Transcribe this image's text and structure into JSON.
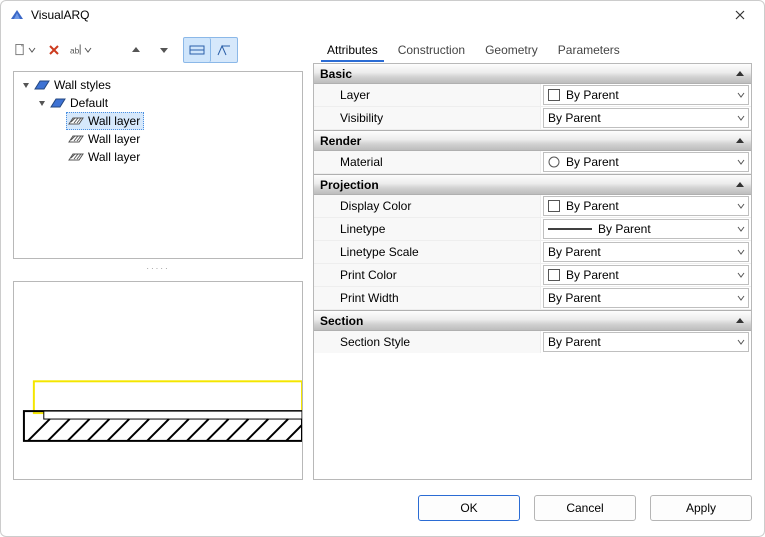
{
  "window": {
    "title": "VisualARQ"
  },
  "toolbar": {
    "icons": {
      "new": "new-icon",
      "delete": "delete-icon",
      "rename": "rename-icon",
      "up": "up-icon",
      "down": "down-icon",
      "wall_view": "wall-view-icon",
      "section_view": "section-view-icon"
    }
  },
  "tree": {
    "root_label": "Wall styles",
    "nodes": [
      {
        "label": "Default",
        "children": [
          {
            "label": "Wall layer",
            "selected": true
          },
          {
            "label": "Wall layer",
            "selected": false
          },
          {
            "label": "Wall layer",
            "selected": false
          }
        ]
      }
    ]
  },
  "tabs": {
    "items": [
      "Attributes",
      "Construction",
      "Geometry",
      "Parameters"
    ],
    "active": 0
  },
  "props": [
    {
      "title": "Basic",
      "rows": [
        {
          "label": "Layer",
          "value": "By Parent",
          "swatch": "box"
        },
        {
          "label": "Visibility",
          "value": "By Parent",
          "swatch": null
        }
      ]
    },
    {
      "title": "Render",
      "rows": [
        {
          "label": "Material",
          "value": "By Parent",
          "swatch": "circle"
        }
      ]
    },
    {
      "title": "Projection",
      "rows": [
        {
          "label": "Display Color",
          "value": "By Parent",
          "swatch": "box"
        },
        {
          "label": "Linetype",
          "value": "By Parent",
          "swatch": "line"
        },
        {
          "label": "Linetype Scale",
          "value": "By Parent",
          "swatch": null
        },
        {
          "label": "Print Color",
          "value": "By Parent",
          "swatch": "box"
        },
        {
          "label": "Print Width",
          "value": "By Parent",
          "swatch": null
        }
      ]
    },
    {
      "title": "Section",
      "rows": [
        {
          "label": "Section Style",
          "value": "By Parent",
          "swatch": null
        }
      ]
    }
  ],
  "footer": {
    "ok": "OK",
    "cancel": "Cancel",
    "apply": "Apply"
  }
}
